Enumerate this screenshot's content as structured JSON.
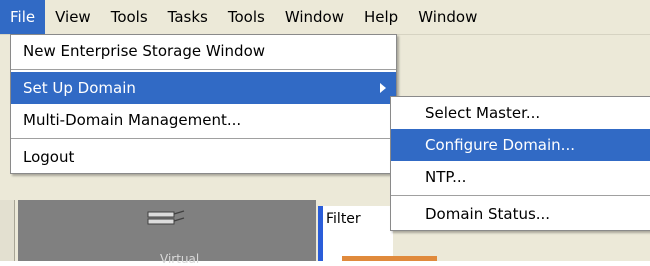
{
  "menubar": {
    "items": [
      "File",
      "View",
      "Tools",
      "Tasks",
      "Tools",
      "Window",
      "Help",
      "Window"
    ]
  },
  "file_menu": {
    "items": [
      {
        "label": "New Enterprise Storage Window"
      },
      {
        "label": "Set Up Domain",
        "submenu": true
      },
      {
        "label": "Multi-Domain Management..."
      },
      {
        "label": "Logout"
      }
    ]
  },
  "submenu": {
    "items": [
      {
        "label": "Select Master..."
      },
      {
        "label": "Configure Domain..."
      },
      {
        "label": "NTP..."
      },
      {
        "label": "Domain Status..."
      }
    ]
  },
  "background": {
    "filter_label": "Filter",
    "panel_label": "Virtual"
  },
  "colors": {
    "highlight": "#316ac5",
    "menubar_bg": "#ece9d8",
    "accent_blue": "#2a5dd9",
    "accent_orange": "#e08a3c"
  }
}
